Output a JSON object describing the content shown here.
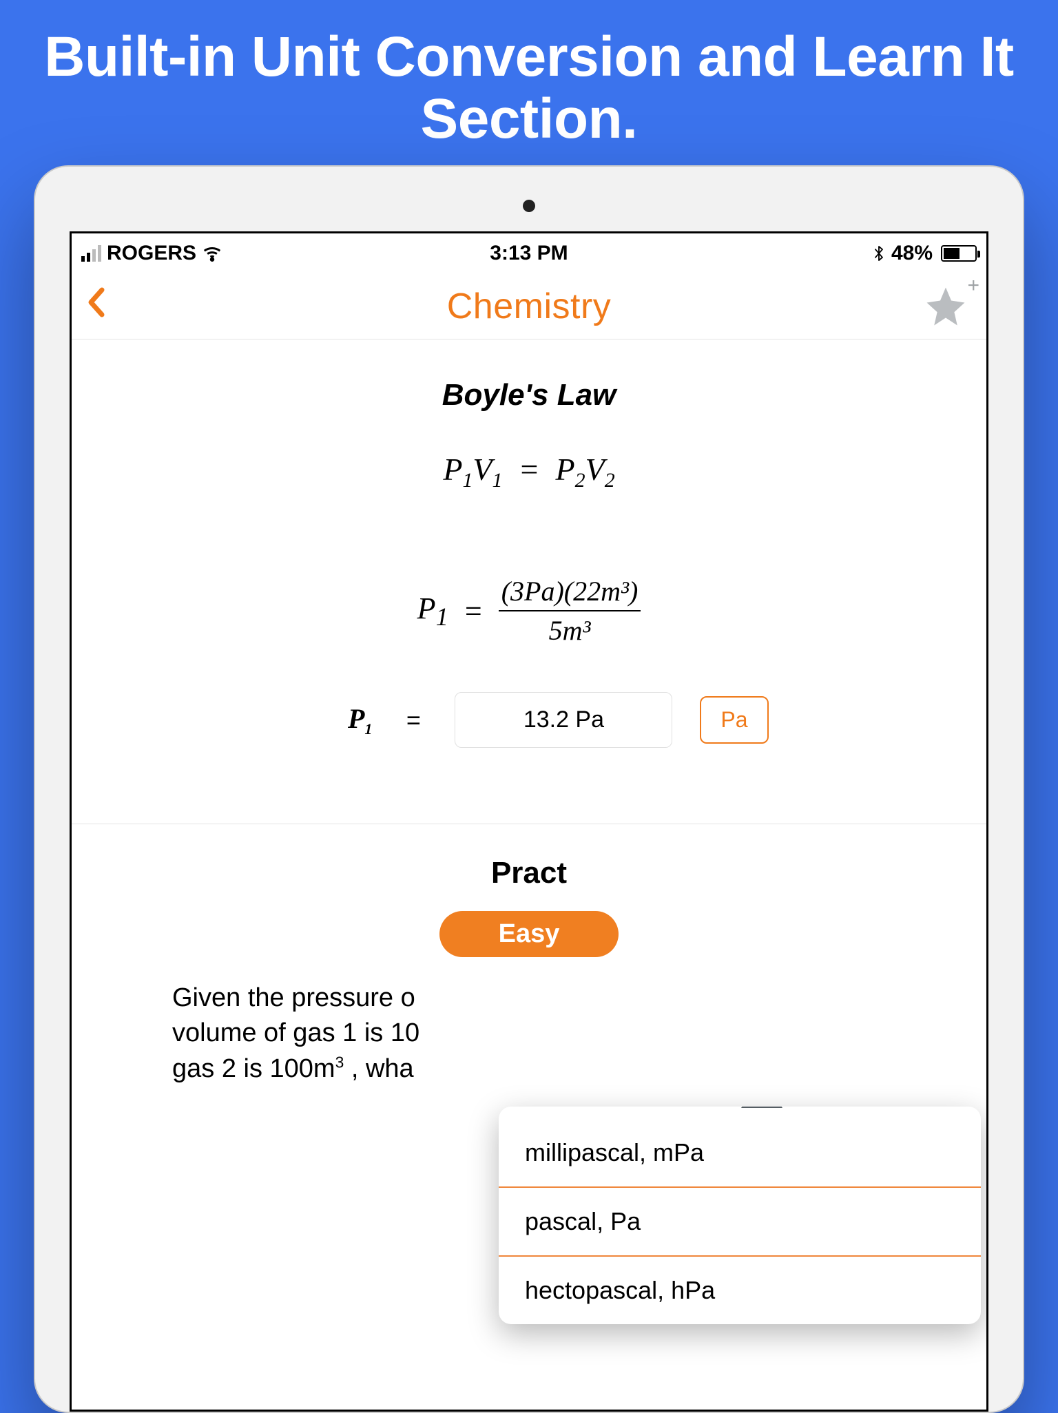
{
  "headline": "Built-in Unit Conversion and Learn It Section.",
  "statusbar": {
    "carrier": "ROGERS",
    "time": "3:13 PM",
    "battery_percent": "48%"
  },
  "navbar": {
    "title": "Chemistry"
  },
  "lesson": {
    "title": "Boyle's Law",
    "formula_lhs": "P",
    "formula_sub1": "1",
    "formula_v": "V",
    "formula_rhs": "P",
    "formula_sub2": "2",
    "worked_lhs": "P",
    "worked_sub": "1",
    "worked_num": "(3Pa)(22m³)",
    "worked_den": "5m³",
    "result_var": "P",
    "result_sub": "1",
    "result_value": "13.2 Pa",
    "unit_button": "Pa"
  },
  "practice": {
    "heading": "Pract",
    "difficulty": "Easy",
    "question_l1": "Given the pressure o",
    "question_l2": "volume of gas 1 is 10",
    "question_l3_a": "gas 2 is 100m",
    "question_l3_b": " , wha"
  },
  "unit_popup": {
    "items": [
      "millipascal, mPa",
      "pascal, Pa",
      "hectopascal, hPa"
    ]
  }
}
